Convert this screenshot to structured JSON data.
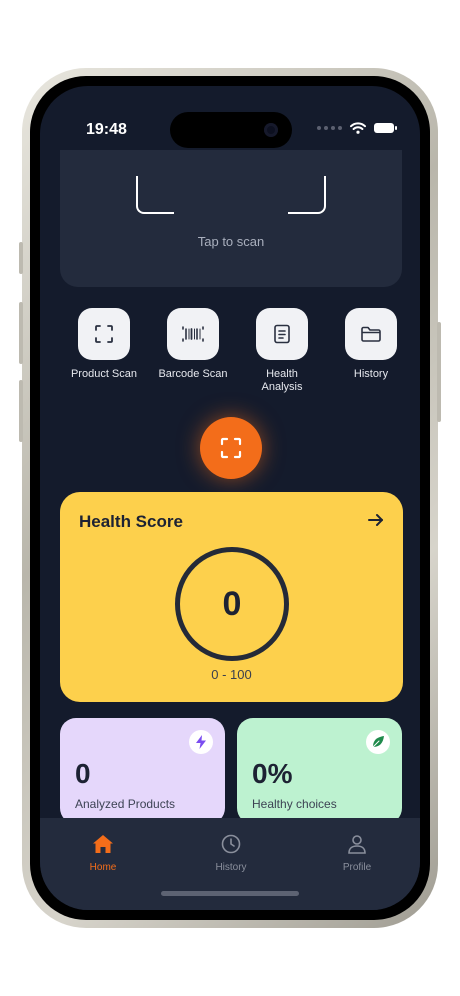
{
  "status": {
    "time": "19:48"
  },
  "scanner": {
    "hint": "Tap to scan"
  },
  "quick_actions": [
    {
      "label": "Product Scan",
      "icon": "scan-frame-icon"
    },
    {
      "label": "Barcode Scan",
      "icon": "barcode-icon"
    },
    {
      "label": "Health\nAnalysis",
      "icon": "document-icon"
    },
    {
      "label": "History",
      "icon": "folder-icon"
    }
  ],
  "health_card": {
    "title": "Health Score",
    "score": "0",
    "range": "0 - 100",
    "color": "#fdd04c"
  },
  "stats": [
    {
      "value": "0",
      "label": "Analyzed Products",
      "icon": "lightning-icon",
      "color": "#e5d7fb"
    },
    {
      "value": "0%",
      "label": "Healthy choices",
      "icon": "leaf-icon",
      "color": "#bdf2d0"
    }
  ],
  "tabs": [
    {
      "label": "Home",
      "icon": "home-icon",
      "active": true
    },
    {
      "label": "History",
      "icon": "clock-icon",
      "active": false
    },
    {
      "label": "Profile",
      "icon": "person-icon",
      "active": false
    }
  ],
  "colors": {
    "accent": "#f36d1a",
    "background": "#141b2c",
    "surface": "#232b3d"
  }
}
